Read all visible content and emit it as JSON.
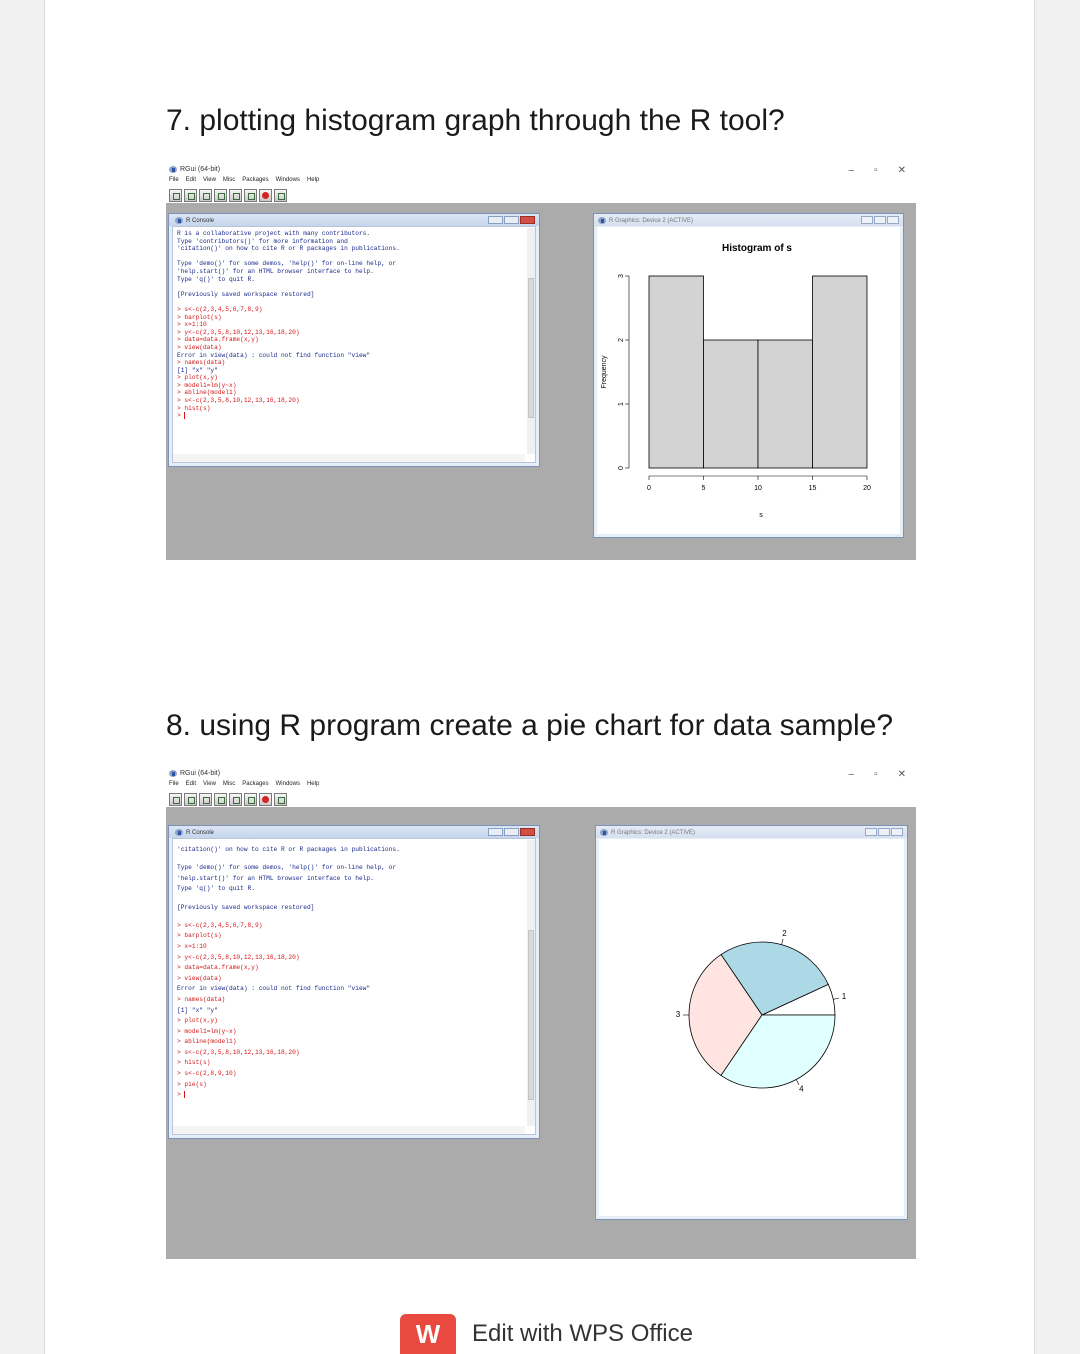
{
  "questions": {
    "q7": "7. plotting histogram graph through the R tool?",
    "q8": "8. using R program create a pie chart for data sample?"
  },
  "rgui": {
    "title": "RGui (64-bit)",
    "menu": [
      "File",
      "Edit",
      "View",
      "Misc",
      "Packages",
      "Windows",
      "Help"
    ],
    "window_controls": [
      "–",
      "▫",
      "✕"
    ]
  },
  "console1": {
    "title": "R Console",
    "lines": [
      {
        "t": "R is a collaborative project with many contributors.",
        "cmd": false
      },
      {
        "t": "Type 'contributors()' for more information and",
        "cmd": false
      },
      {
        "t": "'citation()' on how to cite R or R packages in publications.",
        "cmd": false
      },
      {
        "t": "",
        "cmd": false
      },
      {
        "t": "Type 'demo()' for some demos, 'help()' for on-line help, or",
        "cmd": false
      },
      {
        "t": "'help.start()' for an HTML browser interface to help.",
        "cmd": false
      },
      {
        "t": "Type 'q()' to quit R.",
        "cmd": false
      },
      {
        "t": "",
        "cmd": false
      },
      {
        "t": "[Previously saved workspace restored]",
        "cmd": false
      },
      {
        "t": "",
        "cmd": false
      },
      {
        "t": "> s<-c(2,3,4,5,6,7,8,9)",
        "cmd": true
      },
      {
        "t": "> barplot(s)",
        "cmd": true
      },
      {
        "t": "> x=1:10",
        "cmd": true
      },
      {
        "t": "> y<-c(2,3,5,8,10,12,13,16,18,20)",
        "cmd": true
      },
      {
        "t": "> data=data.frame(x,y)",
        "cmd": true
      },
      {
        "t": "> view(data)",
        "cmd": true
      },
      {
        "t": "Error in view(data) : could not find function \"view\"",
        "cmd": false
      },
      {
        "t": "> names(data)",
        "cmd": true
      },
      {
        "t": "[1] \"x\" \"y\"",
        "cmd": false
      },
      {
        "t": "> plot(x,y)",
        "cmd": true
      },
      {
        "t": "> model1=lm(y~x)",
        "cmd": true
      },
      {
        "t": "> abline(model1)",
        "cmd": true
      },
      {
        "t": "> s<-c(2,3,5,8,10,12,13,16,18,20)",
        "cmd": true
      },
      {
        "t": "> hist(s)",
        "cmd": true
      }
    ]
  },
  "console2": {
    "title": "R Console",
    "lines": [
      {
        "t": "'citation()' on how to cite R or R packages in publications.",
        "cmd": false
      },
      {
        "t": "",
        "cmd": false
      },
      {
        "t": "Type 'demo()' for some demos, 'help()' for on-line help, or",
        "cmd": false
      },
      {
        "t": "'help.start()' for an HTML browser interface to help.",
        "cmd": false
      },
      {
        "t": "Type 'q()' to quit R.",
        "cmd": false
      },
      {
        "t": "",
        "cmd": false
      },
      {
        "t": "[Previously saved workspace restored]",
        "cmd": false
      },
      {
        "t": "",
        "cmd": false
      },
      {
        "t": "> s<-c(2,3,4,5,6,7,8,9)",
        "cmd": true
      },
      {
        "t": "> barplot(s)",
        "cmd": true
      },
      {
        "t": "> x=1:10",
        "cmd": true
      },
      {
        "t": "> y<-c(2,3,5,8,10,12,13,16,18,20)",
        "cmd": true
      },
      {
        "t": "> data=data.frame(x,y)",
        "cmd": true
      },
      {
        "t": "> view(data)",
        "cmd": true
      },
      {
        "t": "Error in view(data) : could not find function \"view\"",
        "cmd": false
      },
      {
        "t": "> names(data)",
        "cmd": true
      },
      {
        "t": "[1] \"x\" \"y\"",
        "cmd": false
      },
      {
        "t": "> plot(x,y)",
        "cmd": true
      },
      {
        "t": "> model1=lm(y~x)",
        "cmd": true
      },
      {
        "t": "> abline(model1)",
        "cmd": true
      },
      {
        "t": "> s<-c(2,3,5,8,10,12,13,16,18,20)",
        "cmd": true
      },
      {
        "t": "> hist(s)",
        "cmd": true
      },
      {
        "t": "> s<-c(2,8,9,10)",
        "cmd": true
      },
      {
        "t": "> pie(s)",
        "cmd": true
      }
    ]
  },
  "graphics_title": "R Graphics: Device 2 (ACTIVE)",
  "colors": {
    "bar_fill": "#d3d3d3",
    "pie_1": "#ffffff",
    "pie_2": "#add8e6",
    "pie_3": "#ffe4e1",
    "pie_4": "#e0ffff",
    "prompt_red": "#d51717",
    "console_blue": "#1a2a8a"
  },
  "chart_data": [
    {
      "type": "bar",
      "title": "Histogram of s",
      "xlabel": "s",
      "ylabel": "Frequency",
      "bins": [
        [
          0,
          5
        ],
        [
          5,
          10
        ],
        [
          10,
          15
        ],
        [
          15,
          20
        ]
      ],
      "values": [
        3,
        2,
        2,
        3
      ],
      "xticks": [
        0,
        5,
        10,
        15,
        20
      ],
      "yticks": [
        0,
        1,
        2,
        3
      ],
      "xlim": [
        0,
        20
      ],
      "ylim": [
        0,
        3
      ]
    },
    {
      "type": "pie",
      "labels": [
        "1",
        "2",
        "3",
        "4"
      ],
      "values": [
        2,
        8,
        9,
        10
      ],
      "colors": [
        "#ffffff",
        "#add8e6",
        "#ffe4e1",
        "#e0ffff"
      ]
    }
  ],
  "footer": {
    "logo": "W",
    "text": "Edit with WPS Office"
  }
}
